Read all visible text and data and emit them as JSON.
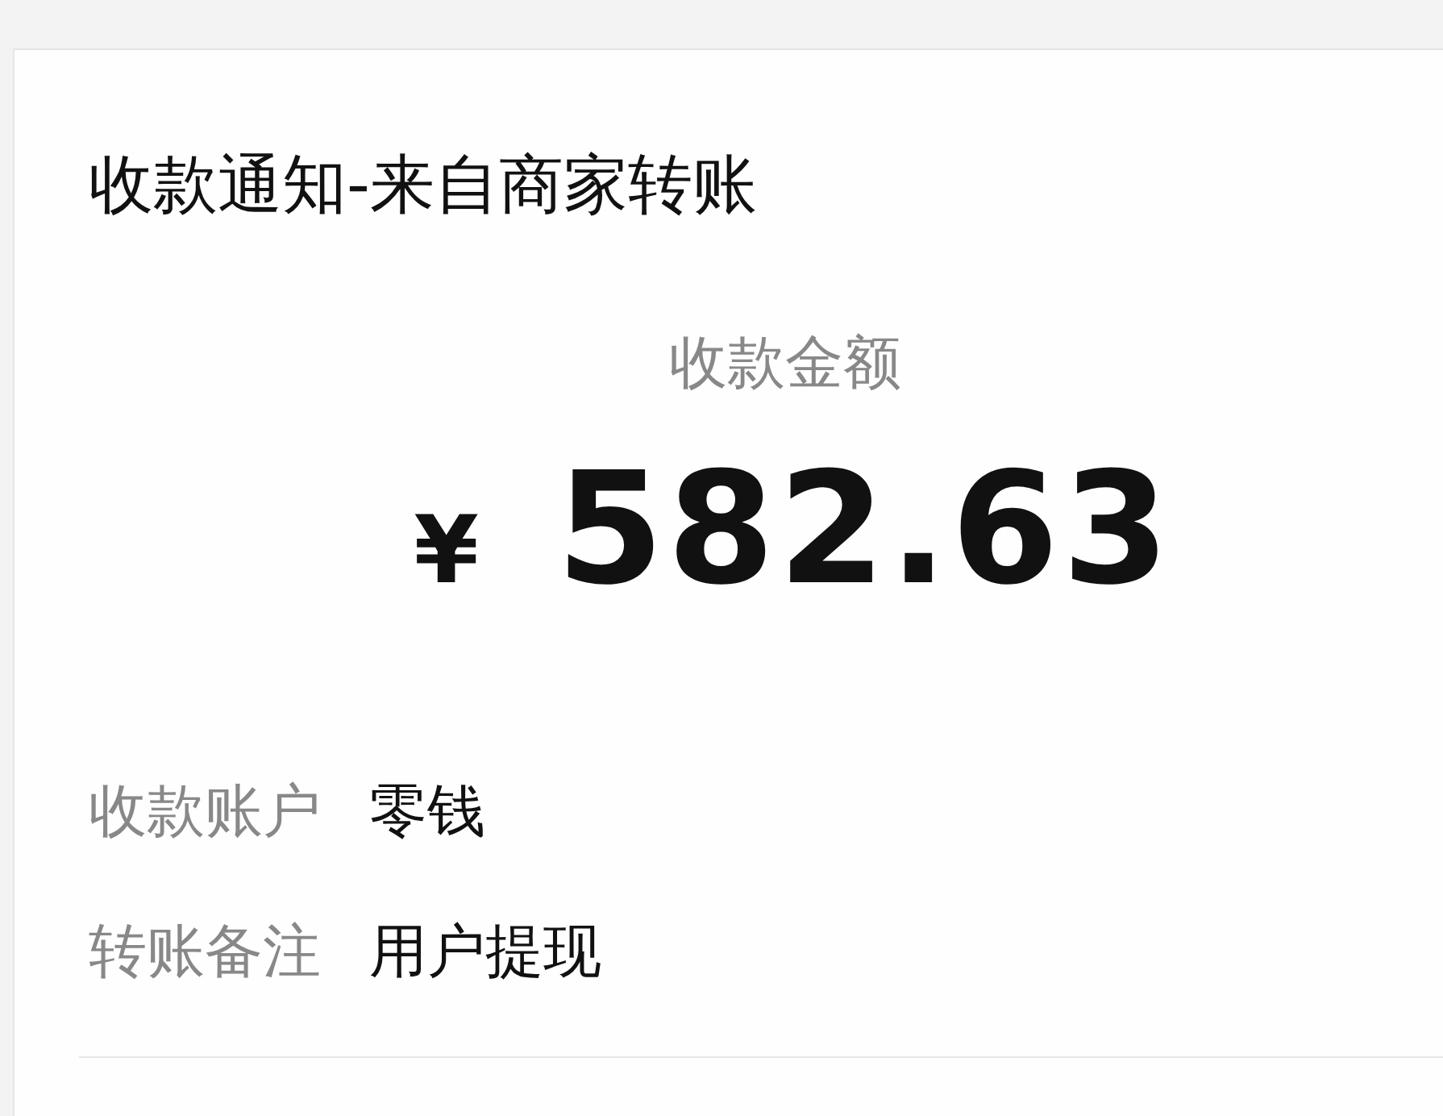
{
  "card": {
    "title": "收款通知-来自商家转账",
    "amount_label": "收款金额",
    "currency": "¥",
    "amount": "582.63",
    "rows": [
      {
        "label": "收款账户",
        "value": "零钱"
      },
      {
        "label": "转账备注",
        "value": "用户提现"
      }
    ]
  }
}
